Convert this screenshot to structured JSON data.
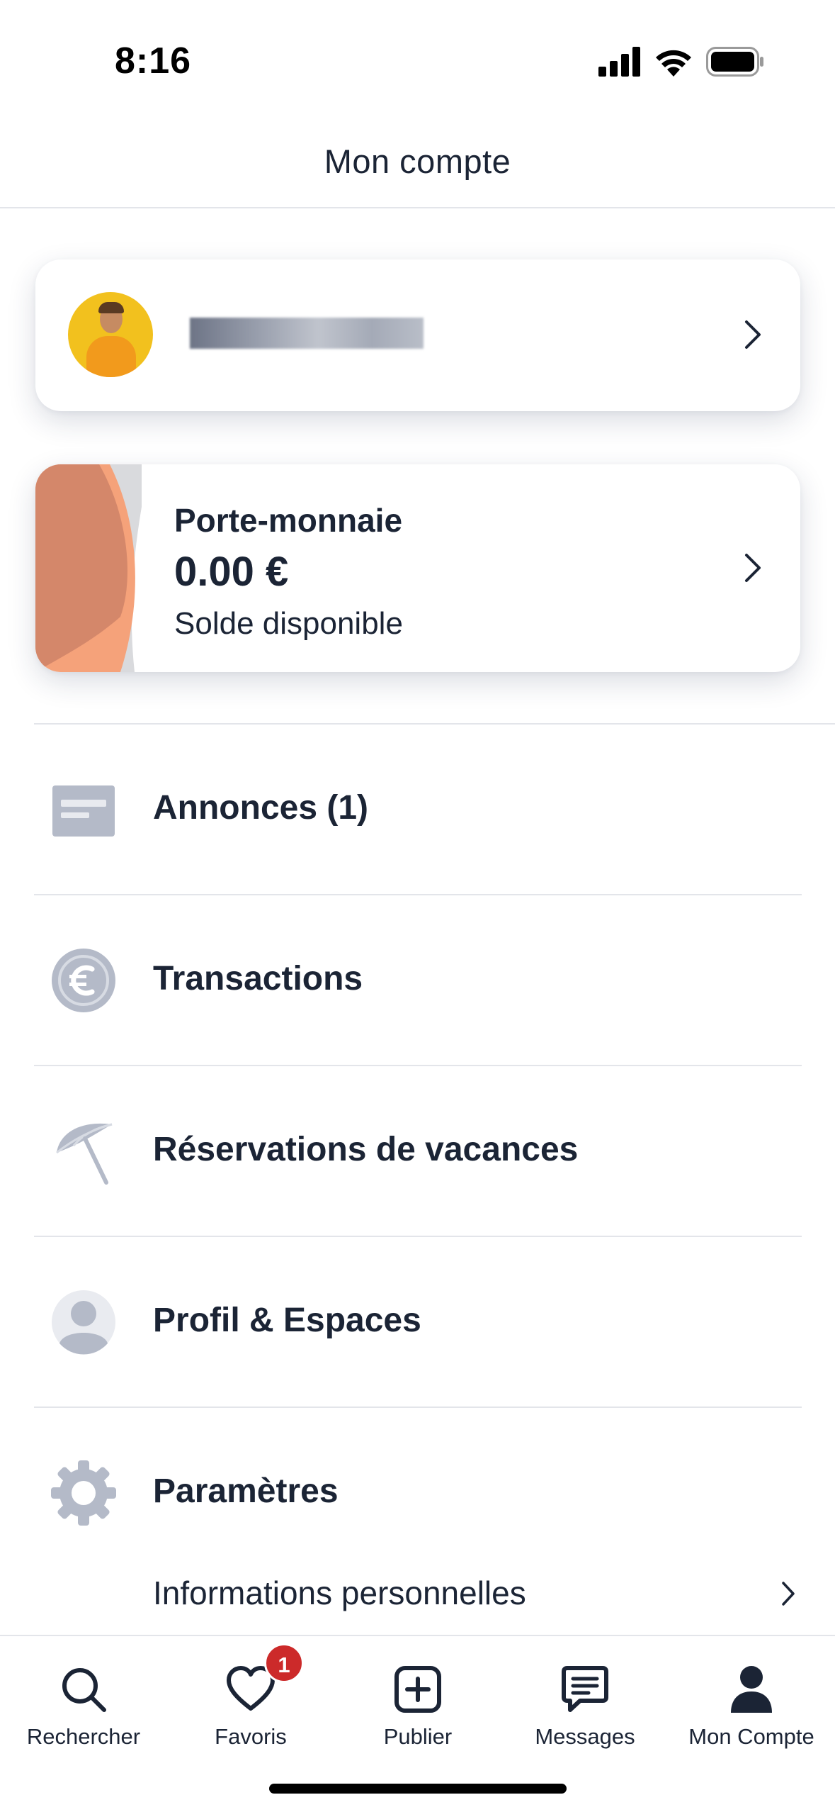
{
  "status_bar": {
    "time": "8:16"
  },
  "header": {
    "title": "Mon compte"
  },
  "profile": {
    "avatar_alt": "avatar"
  },
  "wallet": {
    "label": "Porte-monnaie",
    "amount": "0.00 €",
    "subtitle": "Solde disponible",
    "colors": {
      "peach": "#f5a27a",
      "terracotta": "#d4876a",
      "gray": "#d9dadd"
    }
  },
  "menu": [
    {
      "label": "Annonces (1)",
      "icon": "listing-card-icon"
    },
    {
      "label": "Transactions",
      "icon": "euro-coin-icon"
    },
    {
      "label": "Réservations de vacances",
      "icon": "beach-umbrella-icon"
    },
    {
      "label": "Profil & Espaces",
      "icon": "person-icon"
    },
    {
      "label": "Paramètres",
      "icon": "gear-icon"
    }
  ],
  "settings_sub": {
    "label": "Informations personnelles"
  },
  "tabs": [
    {
      "label": "Rechercher",
      "icon": "search-icon"
    },
    {
      "label": "Favoris",
      "icon": "heart-icon",
      "badge": "1"
    },
    {
      "label": "Publier",
      "icon": "plus-square-icon"
    },
    {
      "label": "Messages",
      "icon": "message-icon"
    },
    {
      "label": "Mon Compte",
      "icon": "user-icon",
      "active": true
    }
  ],
  "theme": {
    "text": "#1b2435",
    "icon_gray": "#b4bac8",
    "badge": "#cc2a2a"
  }
}
